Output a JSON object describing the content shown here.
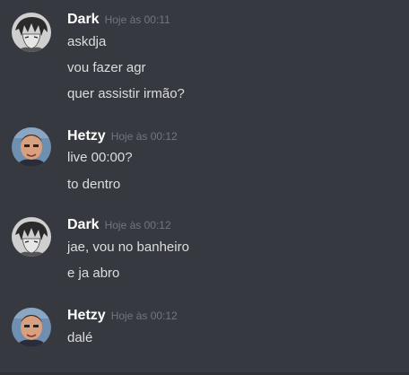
{
  "messages": [
    {
      "author": "Dark",
      "timestamp": "Hoje às 00:11",
      "avatar_icon": "anime-character-avatar-icon",
      "lines": [
        "askdja",
        "vou fazer agr",
        "quer assistir irmão?"
      ]
    },
    {
      "author": "Hetzy",
      "timestamp": "Hoje às 00:12",
      "avatar_icon": "person-photo-avatar-icon",
      "lines": [
        "live 00:00?",
        "to dentro"
      ]
    },
    {
      "author": "Dark",
      "timestamp": "Hoje às 00:12",
      "avatar_icon": "anime-character-avatar-icon",
      "lines": [
        "jae, vou no banheiro",
        "e ja abro"
      ]
    },
    {
      "author": "Hetzy",
      "timestamp": "Hoje às 00:12",
      "avatar_icon": "person-photo-avatar-icon",
      "lines": [
        "dalé"
      ]
    }
  ],
  "colors": {
    "background": "#36393f",
    "username": "#ffffff",
    "message_text": "#dcddde",
    "timestamp": "#72767d"
  }
}
